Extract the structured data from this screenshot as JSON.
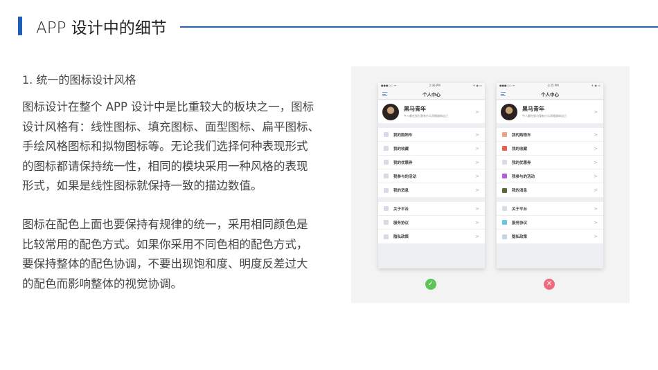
{
  "header": {
    "title": "APP 设计中的细节"
  },
  "section": {
    "heading": "1. 统一的图标设计风格",
    "paragraph1": [
      "图标设计在整个 APP 设计中是比重较大的板块之一，图标",
      "设计风格有：线性图标、填充图标、面型图标、扁平图标、",
      "手绘风格图标和拟物图标等。无论我们选择何种表现形式",
      "的图标都请保持统一性，相同的模块采用一种风格的表现",
      "形式，如果是线性图标就保持一致的描边数值。"
    ],
    "paragraph2": [
      "图标在配色上面也要保持有规律的统一，采用相同颜色是",
      "比较常用的配色方式。如果你采用不同色相的配色方式，",
      "要保持整体的配色协调，不要出现饱和度、明度反差过大",
      "的配色而影响整体的视觉协调。"
    ]
  },
  "phones": [
    {
      "time": "2:36 PM",
      "signal": "●●●○○ ᯤ",
      "battery": "✈ ◉ ▭",
      "nav_title": "个人中心",
      "name": "黑马青年",
      "subtitle": "牛人都在努力我有什么资格放纵自己",
      "chevron": ">",
      "group1": [
        {
          "label": "我的购物车",
          "icon": "cart-icon",
          "color": "#d7dbe6"
        },
        {
          "label": "我的收藏",
          "icon": "heart-icon",
          "color": "#d7dbe6"
        },
        {
          "label": "我的优惠券",
          "icon": "tag-icon",
          "color": "#d7dbe6"
        },
        {
          "label": "我参与的活动",
          "icon": "flag-icon",
          "color": "#d7dbe6"
        },
        {
          "label": "我的消息",
          "icon": "message-icon",
          "color": "#d7dbe6"
        }
      ],
      "group2": [
        {
          "label": "关于平台",
          "icon": "info-icon",
          "color": "#d7dbe6"
        },
        {
          "label": "服务协议",
          "icon": "bookmark-icon",
          "color": "#d7dbe6"
        },
        {
          "label": "隐私政策",
          "icon": "privacy-icon",
          "color": "#d7dbe6"
        }
      ],
      "verdict": "check-icon",
      "verdict_glyph": "✓"
    },
    {
      "time": "2:35 PM",
      "signal": "●●●○○ ᯤ",
      "battery": "✈ ◉ ▭",
      "nav_title": "个人中心",
      "name": "黑马青年",
      "subtitle": "牛人都在努力我有什么资格放纵自己",
      "chevron": ">",
      "group1": [
        {
          "label": "我的购物车",
          "icon": "cart-icon",
          "color": "#e8a58c"
        },
        {
          "label": "我的收藏",
          "icon": "heart-icon",
          "color": "#e8604c"
        },
        {
          "label": "我的优惠券",
          "icon": "tag-icon",
          "color": "#d7dbe6"
        },
        {
          "label": "我参与的活动",
          "icon": "flag-icon",
          "color": "#b45ad8"
        },
        {
          "label": "我的消息",
          "icon": "message-icon",
          "color": "#5a6a3a"
        }
      ],
      "group2": [
        {
          "label": "关于平台",
          "icon": "info-icon",
          "color": "#d7dbe6"
        },
        {
          "label": "服务协议",
          "icon": "bookmark-icon",
          "color": "#6cc6e0"
        },
        {
          "label": "隐私政策",
          "icon": "privacy-icon",
          "color": "#c9d3e6"
        }
      ],
      "verdict": "cross-icon",
      "verdict_glyph": "✕"
    }
  ]
}
